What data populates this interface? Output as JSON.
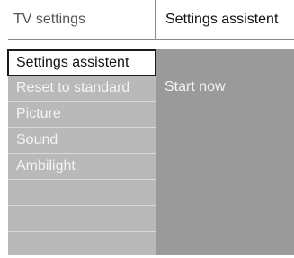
{
  "header": {
    "left_title": "TV settings",
    "right_title": "Settings assistent"
  },
  "menu": {
    "selected_index": 0,
    "items": [
      {
        "label": "Settings assistent"
      },
      {
        "label": "Reset to standard"
      },
      {
        "label": "Picture"
      },
      {
        "label": "Sound"
      },
      {
        "label": "Ambilight"
      },
      {
        "label": ""
      },
      {
        "label": ""
      },
      {
        "label": ""
      }
    ]
  },
  "panel": {
    "option": "Start now"
  },
  "colors": {
    "menu_background": "#b9b9b9",
    "panel_background": "#9a9a9a",
    "selection_border": "#1a1a1a"
  }
}
